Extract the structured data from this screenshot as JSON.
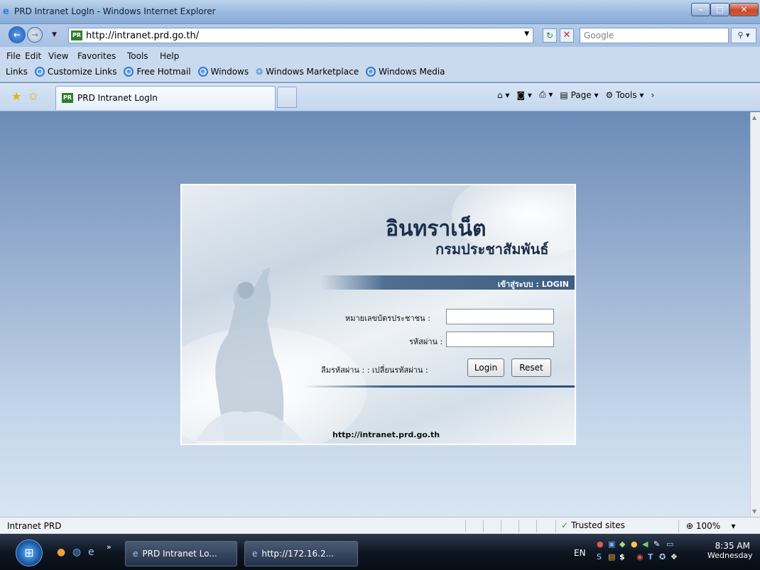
{
  "window": {
    "title": "PRD Intranet LogIn - Windows Internet Explorer",
    "minimize_label": "–",
    "maximize_label": "□",
    "close_label": "✕"
  },
  "nav": {
    "address": "http://intranet.prd.go.th/",
    "search_placeholder": "Google"
  },
  "menu": {
    "items": [
      "File",
      "Edit",
      "View",
      "Favorites",
      "Tools",
      "Help"
    ]
  },
  "links": {
    "label": "Links",
    "items": [
      "Customize Links",
      "Free Hotmail",
      "Windows",
      "Windows Marketplace",
      "Windows Media"
    ]
  },
  "tabs": {
    "active": "PRD Intranet LogIn"
  },
  "command_bar": {
    "page_label": "Page",
    "tools_label": "Tools"
  },
  "login": {
    "brand_title": "อินทราเน็ต",
    "brand_subtitle": "กรมประชาสัมพันธ์",
    "bar_label": "เข้าสู่ระบบ : LOGIN",
    "id_label": "หมายเลขบัตรประชาชน :",
    "password_label": "รหัสผ่าน :",
    "id_value": "",
    "password_value": "",
    "forgot_label": "ลืมรหัสผ่าน : : เปลี่ยนรหัสผ่าน :",
    "login_button": "Login",
    "reset_button": "Reset",
    "footer_url": "http://intranet.prd.go.th"
  },
  "status": {
    "text": "Intranet PRD",
    "zone": "Trusted sites",
    "zoom": "100%"
  },
  "taskbar": {
    "tasks": [
      "PRD Intranet Lo...",
      "http://172.16.2..."
    ],
    "lang": "EN",
    "time": "8:35 AM",
    "day": "Wednesday"
  },
  "colors": {
    "desktop_bg": "#6d8db5",
    "login_bar": "#3e5e82",
    "close_red": "#c74a2c"
  }
}
